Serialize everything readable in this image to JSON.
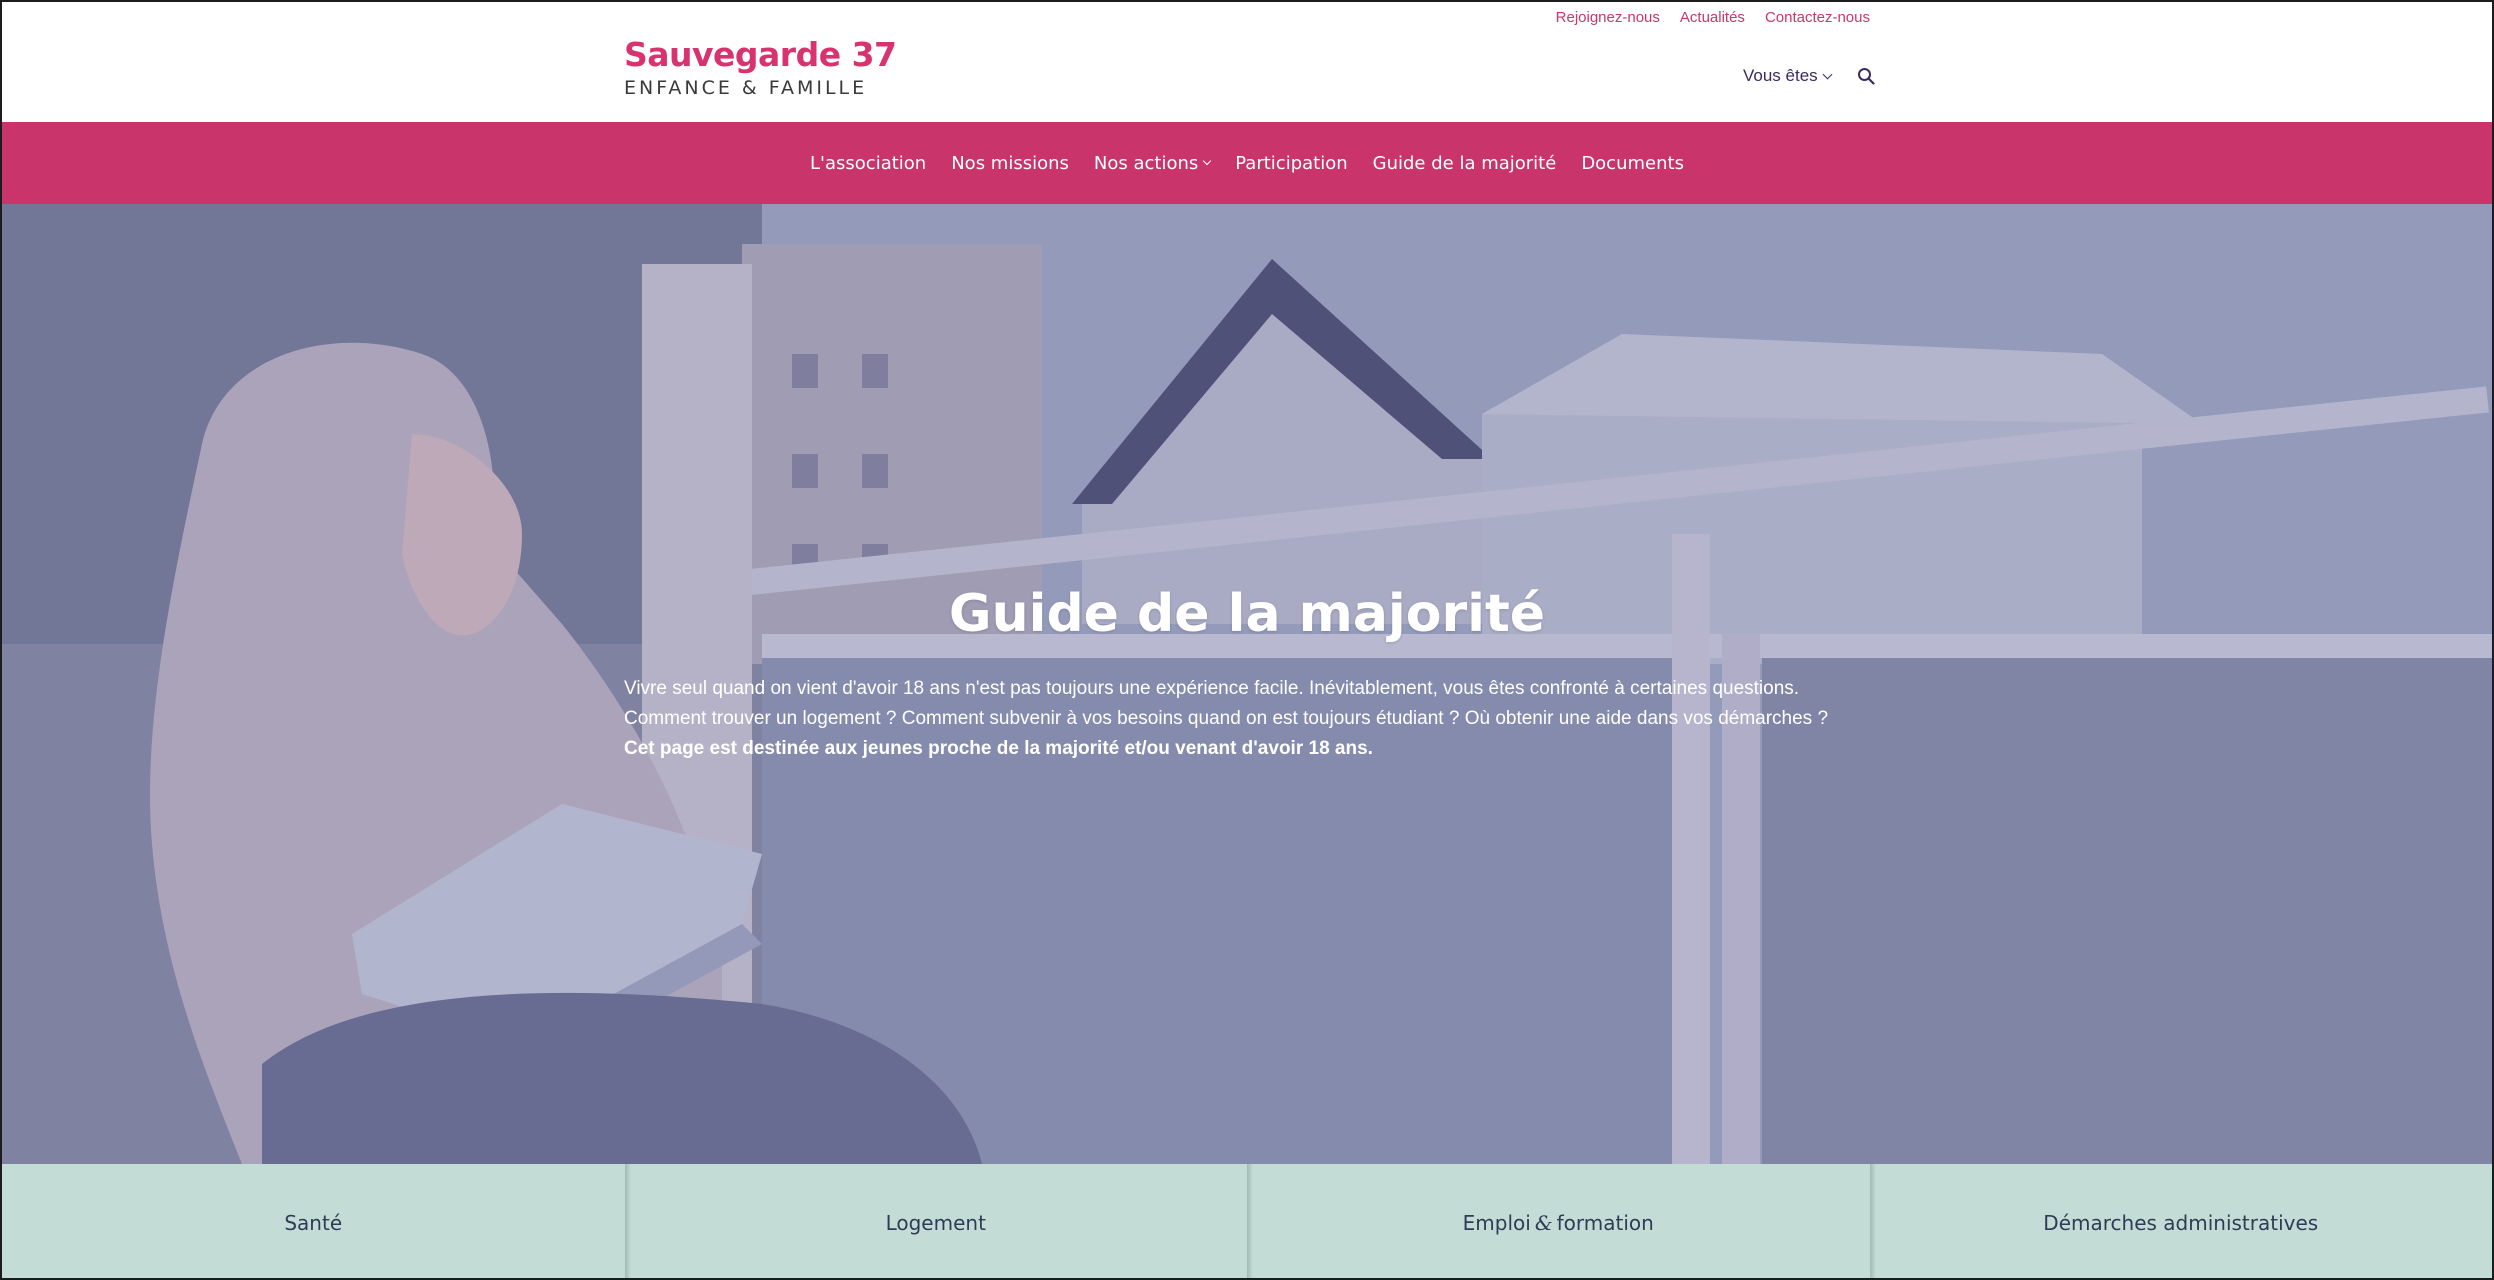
{
  "header": {
    "logo_main": "Sauvegarde 37",
    "logo_sub": "ENFANCE & FAMILLE",
    "top_links": [
      "Rejoignez-nous",
      "Actualités",
      "Contactez-nous"
    ],
    "you_are": "Vous êtes",
    "search_icon": "search-icon"
  },
  "nav": {
    "items": [
      "L'association",
      "Nos missions",
      "Nos actions",
      "Participation",
      "Guide de la majorité",
      "Documents"
    ]
  },
  "hero": {
    "title": "Guide de la majorité",
    "line1": "Vivre seul quand on vient d'avoir 18 ans n'est pas toujours une expérience facile. Inévitablement, vous êtes confronté à certaines questions.",
    "line2": "Comment trouver un logement ? Comment subvenir à vos besoins quand on est toujours étudiant ? Où obtenir une aide dans vos démarches ?",
    "line3": "Cet page est destinée aux jeunes proche de la majorité et/ou venant d'avoir 18 ans."
  },
  "tabs": {
    "sante": "Santé",
    "logement": "Logement",
    "emploi_a": "Emploi",
    "emploi_amp": "&",
    "emploi_b": "formation",
    "demarches": "Démarches administratives"
  },
  "colors": {
    "brand_pink": "#c9346a",
    "logo_pink": "#d8336e",
    "tab_bg": "#c3ddd6",
    "nav_text": "#ffffff"
  }
}
